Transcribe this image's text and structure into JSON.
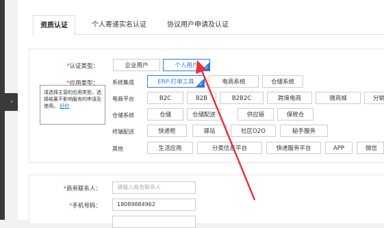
{
  "tabs": [
    "资质认证",
    "个人寄递实名认证",
    "协议用户申请及认证"
  ],
  "form": {
    "auth_type_label": "认证类型：",
    "auth_types": [
      "企业用户",
      "个人用户"
    ],
    "app_type_label": "应用类型：",
    "categories": [
      {
        "name": "系统集成",
        "items": [
          "ERP-打单工具",
          "电商系统",
          "仓储系统"
        ]
      },
      {
        "name": "电商平台",
        "items": [
          "B2C",
          "B2B",
          "B2B2C",
          "跨境电商",
          "微商城",
          "分销"
        ]
      },
      {
        "name": "仓储系统",
        "items": [
          "仓储",
          "仓储配送",
          "供应链",
          "保税仓"
        ]
      },
      {
        "name": "终端配送",
        "items": [
          "快递柜",
          "驿站",
          "社区O2O",
          "秘手服务"
        ]
      },
      {
        "name": "其他",
        "items": [
          "生活应用",
          "分类信息平台",
          "快递服务平台",
          "APP",
          "微信"
        ]
      }
    ],
    "tooltip_text": "请选择主营的应用类型，选择结果不影响服务的申请及使用。",
    "tooltip_link": "好的",
    "contact_label": "商务联系人：",
    "contact_placeholder": "请输入商务联系人",
    "phone_label": "手机号码：",
    "phone_value": "18089884962",
    "required_mark": "*"
  },
  "colors": {
    "accent": "#2a7ae2",
    "annotation_arrow": "#e8323c"
  },
  "icons": {
    "collapse": "chevron-right-icon"
  }
}
